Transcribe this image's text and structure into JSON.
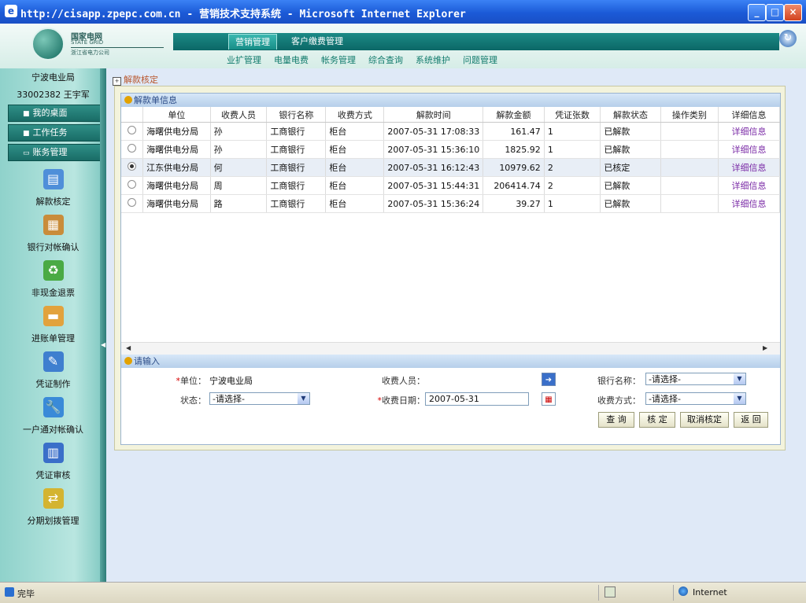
{
  "window": {
    "title": "http://cisapp.zpepc.com.cn - 营销技术支持系统 - Microsoft Internet Explorer"
  },
  "header": {
    "logo_line1": "国家电网",
    "logo_line2": "STATE GRID",
    "logo_line3": "浙江省电力公司",
    "top_tabs": [
      "营销管理",
      "客户缴费管理"
    ],
    "sub_nav": [
      "业扩管理",
      "电量电费",
      "帐务管理",
      "综合查询",
      "系统维护",
      "问题管理"
    ]
  },
  "sidebar": {
    "unit": "宁波电业局",
    "user": "33002382 王宇军",
    "buttons": [
      "我的桌面",
      "工作任务",
      "账务管理"
    ],
    "items": [
      "解款核定",
      "银行对帐确认",
      "非现金退票",
      "进账单管理",
      "凭证制作",
      "一户通对帐确认",
      "凭证审核",
      "分期划拨管理"
    ]
  },
  "breadcrumb": "解款核定",
  "section_titles": {
    "list": "解款单信息",
    "input": "请输入"
  },
  "chart_data": {
    "type": "table",
    "columns": [
      "单位",
      "收费人员",
      "银行名称",
      "收费方式",
      "解款时间",
      "解款金额",
      "凭证张数",
      "解款状态",
      "操作类别",
      "详细信息"
    ],
    "rows": [
      [
        "海曙供电分局",
        "孙",
        "工商银行",
        "柜台",
        "2007-05-31 17:08:33",
        "161.47",
        "1",
        "已解款",
        "",
        "详细信息"
      ],
      [
        "海曙供电分局",
        "孙",
        "工商银行",
        "柜台",
        "2007-05-31 15:36:10",
        "1825.92",
        "1",
        "已解款",
        "",
        "详细信息"
      ],
      [
        "江东供电分局",
        "何",
        "工商银行",
        "柜台",
        "2007-05-31 16:12:43",
        "10979.62",
        "2",
        "已核定",
        "",
        "详细信息"
      ],
      [
        "海曙供电分局",
        "周",
        "工商银行",
        "柜台",
        "2007-05-31 15:44:31",
        "206414.74",
        "2",
        "已解款",
        "",
        "详细信息"
      ],
      [
        "海曙供电分局",
        "路",
        "工商银行",
        "柜台",
        "2007-05-31 15:36:24",
        "39.27",
        "1",
        "已解款",
        "",
        "详细信息"
      ]
    ],
    "selected_row": 2
  },
  "form": {
    "unit_label": "单位：",
    "unit_value": "宁波电业局",
    "collector_label": "收费人员：",
    "bank_label": "银行名称：",
    "bank_value": "-请选择-",
    "status_label": "状态：",
    "status_value": "-请选择-",
    "date_label": "收费日期：",
    "date_value": "2007-05-31",
    "method_label": "收费方式：",
    "method_value": "-请选择-"
  },
  "buttons": {
    "query": "查 询",
    "approve": "核 定",
    "cancel": "取消核定",
    "back": "返 回"
  },
  "status_bar": {
    "left": "完毕",
    "zone": "Internet"
  }
}
